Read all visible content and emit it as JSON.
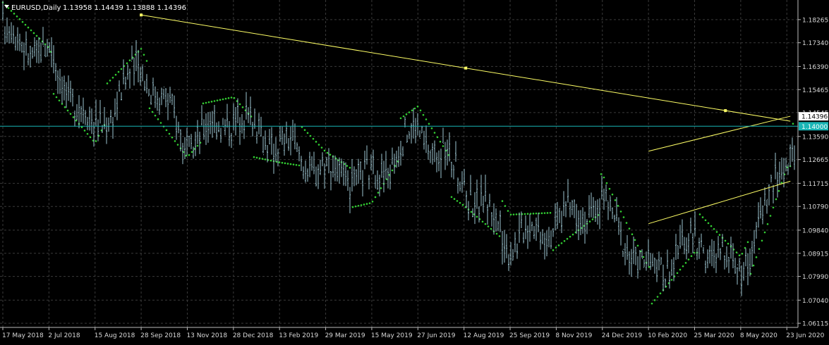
{
  "header": {
    "symbol_label": "EURUSD,Daily",
    "ohlc_label": "1.13958 1.14439 1.13888 1.14396",
    "dropdown_icon": "triangle-down-icon"
  },
  "colors": {
    "background": "#000000",
    "grid": "#3a3a3a",
    "bar": "#9cc5cf",
    "sar": "#32cd32",
    "trendline": "#ffff66",
    "hline": "#19b5b5",
    "axis_text": "#d8d8d8",
    "price_tag_current_bg": "#ffffff",
    "price_tag_current_text": "#000000",
    "price_tag_hline_bg": "#19b5b5",
    "price_tag_hline_text": "#ffffff"
  },
  "chart_data": {
    "type": "line",
    "symbol": "EURUSD",
    "timeframe": "Daily",
    "ohlc_last": {
      "open": 1.13958,
      "high": 1.14439,
      "low": 1.13888,
      "close": 1.14396
    },
    "ylim": [
      1.0595,
      1.1905
    ],
    "y_ticks": [
      "1.18265",
      "1.17340",
      "1.16390",
      "1.15465",
      "1.14545",
      "1.13590",
      "1.12665",
      "1.11715",
      "1.10790",
      "1.09840",
      "1.08915",
      "1.07990",
      "1.07040",
      "1.06115"
    ],
    "x_ticks": [
      "17 May 2018",
      "2 Jul 2018",
      "15 Aug 2018",
      "28 Sep 2018",
      "13 Nov 2018",
      "28 Dec 2018",
      "13 Feb 2019",
      "29 Mar 2019",
      "15 May 2019",
      "27 Jun 2019",
      "12 Aug 2019",
      "25 Sep 2019",
      "8 Nov 2019",
      "24 Dec 2019",
      "10 Feb 2020",
      "25 Mar 2020",
      "8 May 2020",
      "23 Jun 2020"
    ],
    "series": [
      {
        "kind": "close",
        "x": [
          "17 May 2018",
          "2 Jul 2018",
          "15 Aug 2018",
          "28 Sep 2018",
          "13 Nov 2018",
          "28 Dec 2018",
          "13 Feb 2019",
          "29 Mar 2019",
          "15 May 2019",
          "27 Jun 2019",
          "12 Aug 2019",
          "25 Sep 2019",
          "8 Nov 2019",
          "24 Dec 2019",
          "10 Feb 2020",
          "25 Mar 2020",
          "8 May 2020",
          "23 Jun 2020"
        ],
        "values": [
          1.178,
          1.168,
          1.138,
          1.165,
          1.133,
          1.145,
          1.133,
          1.122,
          1.118,
          1.139,
          1.118,
          1.094,
          1.103,
          1.109,
          1.08,
          1.094,
          1.083,
          1.129
        ]
      }
    ],
    "last_price": "1.14396",
    "horizontal_line": {
      "value": "1.14000"
    },
    "trendlines": [
      {
        "from": [
          "28 Sep 2018",
          1.1845
        ],
        "to": [
          "23 Jun 2020",
          1.142
        ]
      },
      {
        "from": [
          "10 Feb 2020",
          1.13
        ],
        "to": [
          "23 Jun 2020",
          1.144
        ]
      },
      {
        "from": [
          "10 Feb 2020",
          1.101
        ],
        "to": [
          "23 Jun 2020",
          1.118
        ]
      }
    ],
    "grid": true
  }
}
